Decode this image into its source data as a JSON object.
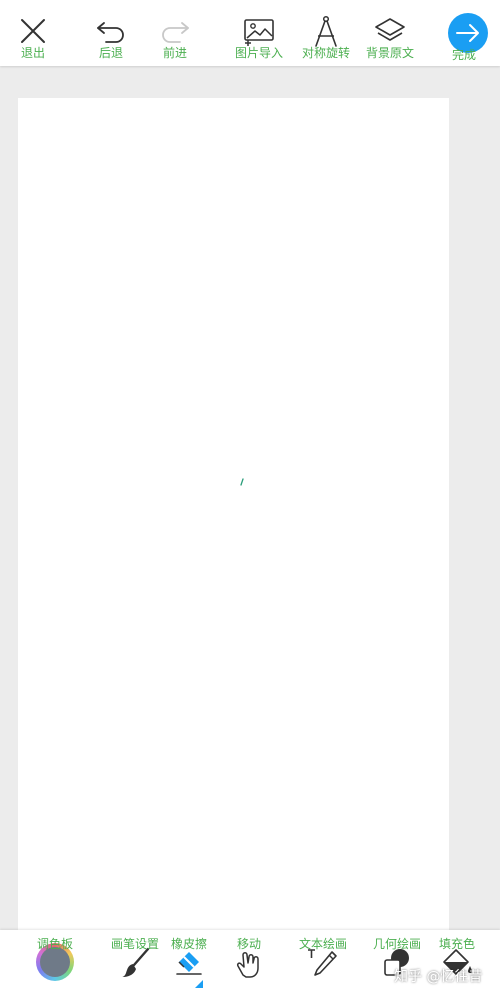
{
  "top_toolbar": {
    "exit_label": "退出",
    "undo_label": "后退",
    "redo_label": "前进",
    "import_image_label": "图片导入",
    "symmetry_label": "对称旋转",
    "background_label": "背景原文",
    "done_label": "完成"
  },
  "bottom_toolbar": {
    "palette_label": "调色板",
    "brush_settings_label": "画笔设置",
    "eraser_label": "橡皮擦",
    "move_label": "移动",
    "text_label": "文本绘画",
    "shapes_label": "几何绘画",
    "fill_label": "填充色"
  },
  "watermark": "知乎 @忆往昔",
  "colors": {
    "accent_green": "#4caf50",
    "accent_blue": "#1a9ef3",
    "workspace": "#ececec",
    "canvas": "#ffffff"
  }
}
